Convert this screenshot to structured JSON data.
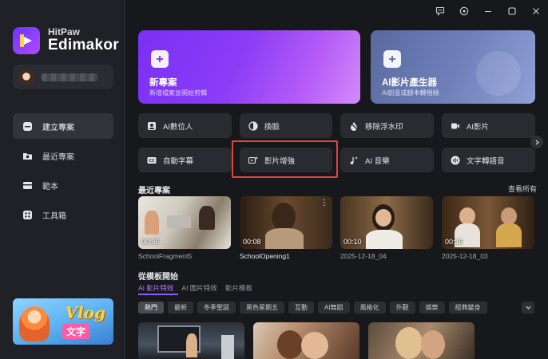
{
  "brand": {
    "line1": "HitPaw",
    "line2": "Edimakor"
  },
  "sidebar": {
    "items": [
      {
        "label": "建立專案",
        "icon": "new-project-icon",
        "active": true
      },
      {
        "label": "最近專案",
        "icon": "folder-icon",
        "active": false
      },
      {
        "label": "範本",
        "icon": "template-icon",
        "active": false
      },
      {
        "label": "工具箱",
        "icon": "toolbox-icon",
        "active": false
      }
    ],
    "promo": {
      "title": "Vlog",
      "subtitle": "文字"
    }
  },
  "hero": {
    "new_project": {
      "title": "新專案",
      "subtitle": "新增檔案並開始剪輯"
    },
    "ai_generator": {
      "title": "AI影片產生器",
      "subtitle": "AI創意或腳本轉視頻"
    }
  },
  "tools": [
    {
      "label": "AI數位人",
      "icon": "digital-human-icon"
    },
    {
      "label": "換臉",
      "icon": "face-swap-icon"
    },
    {
      "label": "移除浮水印",
      "icon": "watermark-remove-icon"
    },
    {
      "label": "AI影片",
      "icon": "ai-video-icon"
    },
    {
      "label": "自動字幕",
      "icon": "caption-icon"
    },
    {
      "label": "影片增強",
      "icon": "video-enhance-icon"
    },
    {
      "label": "AI 音樂",
      "icon": "ai-music-icon"
    },
    {
      "label": "文字轉語音",
      "icon": "text-to-speech-icon"
    }
  ],
  "recent": {
    "title": "最近專案",
    "see_all": "查看所有",
    "projects": [
      {
        "name": "SchoolFragment5",
        "duration": "00:05"
      },
      {
        "name": "SchoolOpening1",
        "duration": "00:08"
      },
      {
        "name": "2025-12-18_04",
        "duration": "00:10"
      },
      {
        "name": "2025-12-18_03",
        "duration": "00:16"
      }
    ]
  },
  "templates": {
    "title": "從模板開始",
    "tabs": [
      "AI 影片特效",
      "AI 圖片特效",
      "影片模板"
    ],
    "chips": [
      "熱門",
      "最新",
      "冬季聖誕",
      "黑色星期五",
      "互動",
      "AI舞蹈",
      "風格化",
      "外觀",
      "娛樂",
      "經典變身"
    ]
  },
  "colors": {
    "accent": "#8b5cf6",
    "highlight": "#e0443a",
    "background": "#17181c"
  }
}
